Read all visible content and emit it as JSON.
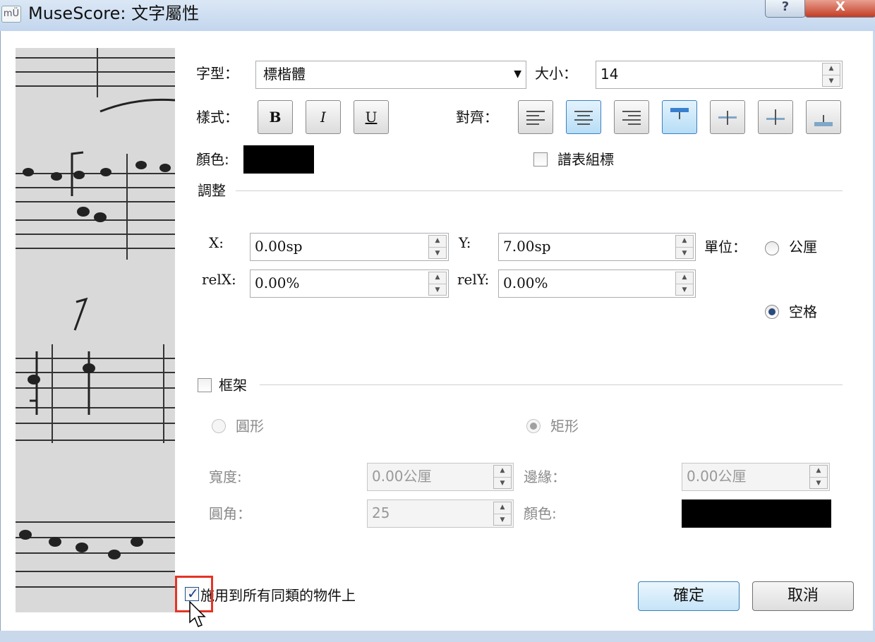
{
  "window": {
    "title": "MuseScore: 文字屬性",
    "app_icon_glyph": "mÜ"
  },
  "titlebar_buttons": {
    "help_glyph": "?",
    "close_glyph": "X"
  },
  "font": {
    "label": "字型：",
    "value": "標楷體",
    "size_label": "大小：",
    "size_value": "14"
  },
  "style": {
    "label": "樣式：",
    "bold_label": "B",
    "italic_label": "I",
    "underline_label": "U",
    "align_label": "對齊：",
    "align_buttons": [
      "align-left",
      "align-center",
      "align-right",
      "align-top",
      "align-vcenter",
      "align-baseline",
      "align-bottom"
    ],
    "checked_aligns": [
      "align-center",
      "align-top"
    ]
  },
  "color": {
    "label": "顏色:",
    "value": "#000000"
  },
  "system_flag": {
    "label": "譜表組標",
    "checked": false
  },
  "adjust": {
    "title": "調整",
    "x_label": "X:",
    "x_value": "0.00sp",
    "y_label": "Y:",
    "y_value": "7.00sp",
    "relx_label": "relX:",
    "relx_value": "0.00%",
    "rely_label": "relY:",
    "rely_value": "0.00%",
    "unit_label": "單位：",
    "unit_mm": "公厘",
    "unit_space": "空格",
    "selected_unit": "空格"
  },
  "frame": {
    "title": "框架",
    "checked": false,
    "circle_label": "圓形",
    "box_label": "矩形",
    "selected_shape": "矩形",
    "width_label": "寬度:",
    "width_value": "0.00公厘",
    "margin_label": "邊緣：",
    "margin_value": "0.00公厘",
    "round_label": "圓角：",
    "round_value": "25",
    "color_label": "顏色:",
    "color_value": "#000000"
  },
  "apply_all": {
    "label": "施用到所有同類的物件上",
    "checked": true
  },
  "buttons": {
    "ok": "確定",
    "cancel": "取消"
  },
  "colors": {
    "highlight": "#e53325",
    "default_button": "#c5e4f8",
    "checked_toggle": "#b7ddf6"
  }
}
